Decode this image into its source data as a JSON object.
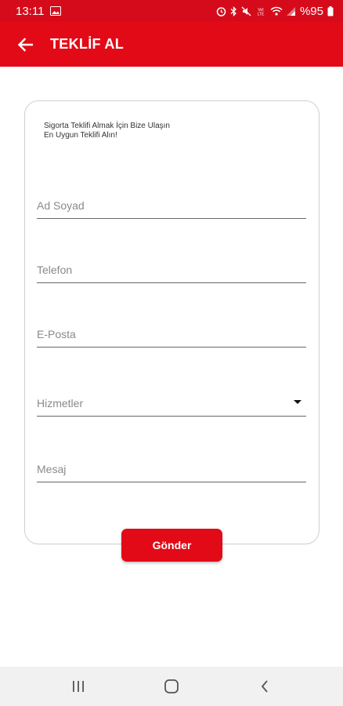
{
  "status_bar": {
    "time": "13:11",
    "battery": "%95"
  },
  "app_bar": {
    "title": "TEKLİF AL"
  },
  "form": {
    "intro_line1": "Sigorta Teklifi Almak İçin Bize Ulaşın",
    "intro_line2": "En Uygun Teklifi Alın!",
    "name_placeholder": "Ad Soyad",
    "phone_placeholder": "Telefon",
    "email_placeholder": "E-Posta",
    "services_selected": "Hizmetler",
    "message_placeholder": "Mesaj",
    "submit_label": "Gönder"
  },
  "colors": {
    "accent": "#e30a17",
    "status_bar": "#d50b1b"
  }
}
